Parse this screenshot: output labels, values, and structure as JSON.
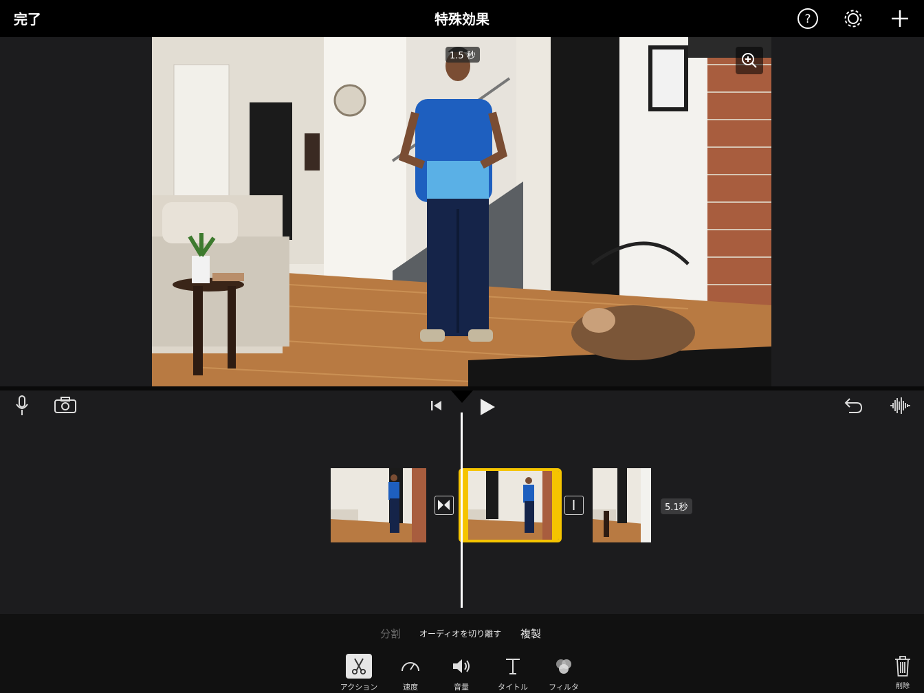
{
  "header": {
    "done_label": "完了",
    "title": "特殊効果",
    "icons": [
      "help-icon",
      "settings-gear-icon",
      "add-plus-icon"
    ]
  },
  "preview": {
    "duration_badge": "1.5 秒",
    "zoom_icon": "zoom-in-icon"
  },
  "timeline": {
    "left_controls": [
      "microphone-icon",
      "camera-icon"
    ],
    "center_controls": [
      "skip-to-start-icon",
      "play-icon"
    ],
    "right_controls": [
      "undo-icon",
      "audio-waveform-icon"
    ],
    "clips": [
      {
        "id": "clip-1",
        "selected": false
      },
      {
        "id": "clip-2",
        "selected": true
      },
      {
        "id": "clip-3",
        "selected": false
      }
    ],
    "transitions": [
      "cross-dissolve-icon",
      "no-transition-icon"
    ],
    "clip_duration": "5.1秒",
    "selection_color": "#f5c400"
  },
  "actions": {
    "split": "分割",
    "detach_audio": "オーディオを切り離す",
    "duplicate": "複製"
  },
  "toolbar": {
    "tools": [
      {
        "label": "アクション",
        "icon": "scissors-icon",
        "active": true
      },
      {
        "label": "速度",
        "icon": "speedometer-icon",
        "active": false
      },
      {
        "label": "音量",
        "icon": "speaker-icon",
        "active": false
      },
      {
        "label": "タイトル",
        "icon": "title-t-icon",
        "active": false
      },
      {
        "label": "フィルタ",
        "icon": "filter-circles-icon",
        "active": false
      }
    ],
    "delete_label": "削除"
  }
}
